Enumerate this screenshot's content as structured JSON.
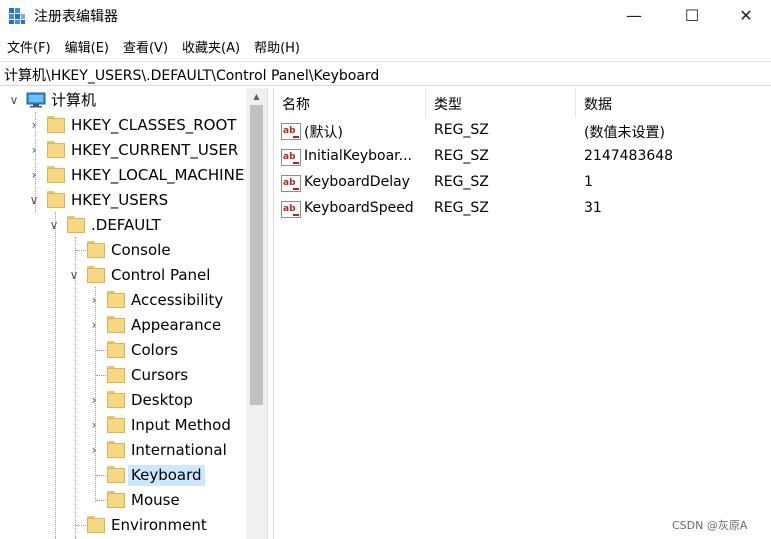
{
  "window": {
    "title": "注册表编辑器"
  },
  "window_controls": {
    "minimize": "—",
    "maximize": "☐",
    "close": "✕"
  },
  "menu": [
    {
      "label": "文件(F)"
    },
    {
      "label": "编辑(E)"
    },
    {
      "label": "查看(V)"
    },
    {
      "label": "收藏夹(A)"
    },
    {
      "label": "帮助(H)"
    }
  ],
  "address": {
    "path": "计算机\\HKEY_USERS\\.DEFAULT\\Control Panel\\Keyboard"
  },
  "tree": {
    "root": "计算机",
    "hives": {
      "classes_root": "HKEY_CLASSES_ROOT",
      "current_user": "HKEY_CURRENT_USER",
      "local_machine": "HKEY_LOCAL_MACHINE",
      "users": "HKEY_USERS"
    },
    "default_key": ".DEFAULT",
    "default_children": {
      "console": "Console",
      "control_panel": "Control Panel",
      "environment": "Environment"
    },
    "control_panel_children": [
      {
        "label": "Accessibility"
      },
      {
        "label": "Appearance"
      },
      {
        "label": "Colors"
      },
      {
        "label": "Cursors"
      },
      {
        "label": "Desktop"
      },
      {
        "label": "Input Method"
      },
      {
        "label": "International"
      },
      {
        "label": "Keyboard"
      },
      {
        "label": "Mouse"
      }
    ]
  },
  "values_pane": {
    "columns": {
      "name": "名称",
      "type": "类型",
      "data": "数据"
    },
    "icon_text": "ab",
    "rows": [
      {
        "name": "(默认)",
        "type": "REG_SZ",
        "data": "(数值未设置)"
      },
      {
        "name": "InitialKeyboar...",
        "type": "REG_SZ",
        "data": "2147483648"
      },
      {
        "name": "KeyboardDelay",
        "type": "REG_SZ",
        "data": "1"
      },
      {
        "name": "KeyboardSpeed",
        "type": "REG_SZ",
        "data": "31"
      }
    ]
  },
  "watermark": "CSDN @灰原A",
  "colors": {
    "selection": "#cce8ff",
    "folder": "#f7d881",
    "folder_border": "#dcb55a",
    "string_icon": "#b3261e"
  }
}
